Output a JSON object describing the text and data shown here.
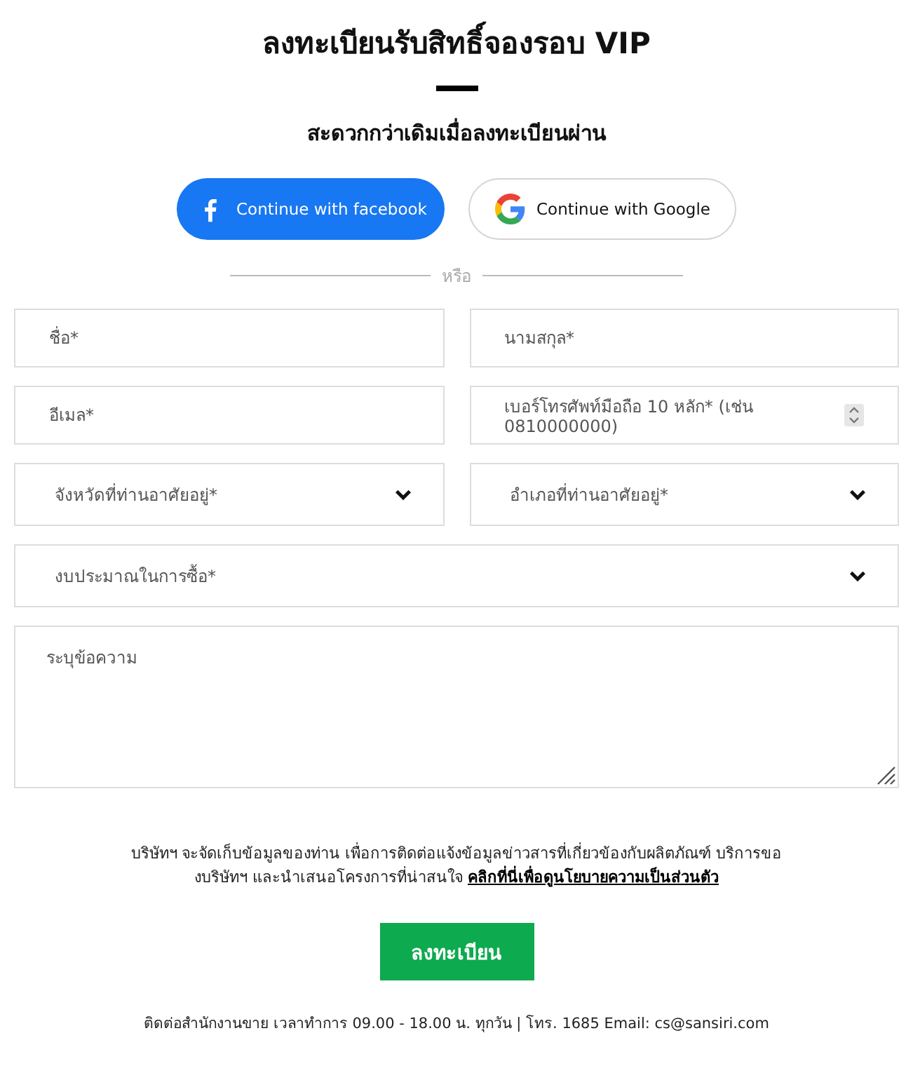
{
  "title": "ลงทะเบียนรับสิทธิ์จองรอบ VIP",
  "subtitle": "สะดวกกว่าเดิมเมื่อลงทะเบียนผ่าน",
  "social_buttons": [
    {
      "kind": "facebook",
      "label": "Continue with facebook"
    },
    {
      "kind": "google",
      "label": "Continue with Google"
    }
  ],
  "divider": "หรือ",
  "field_rows": [
    [
      {
        "kind": "text",
        "placeholder": "ชื่อ*"
      },
      {
        "kind": "text",
        "placeholder": "นามสกุล*"
      }
    ],
    [
      {
        "kind": "text",
        "placeholder": "อีเมล*"
      },
      {
        "kind": "number",
        "placeholder": "เบอร์โทรศัพท์มือถือ 10 หลัก* (เช่น 0810000000)"
      }
    ],
    [
      {
        "kind": "select",
        "placeholder": "จังหวัดที่ท่านอาศัยอยู่*"
      },
      {
        "kind": "select",
        "placeholder": "อำเภอที่ท่านอาศัยอยู่*"
      }
    ],
    [
      {
        "kind": "select",
        "placeholder": "งบประมาณในการซื้อ*"
      }
    ],
    [
      {
        "kind": "textarea",
        "placeholder": "ระบุข้อความ"
      }
    ]
  ],
  "consent": {
    "text": "บริษัทฯ จะจัดเก็บข้อมูลของท่าน เพื่อการติดต่อแจ้งข้อมูลข่าวสารที่เกี่ยวข้องกับผลิตภัณฑ์ บริการของบริษัทฯ และนำเสนอโครงการที่น่าสนใจ",
    "link": "คลิกที่นี่เพื่อดูนโยบายความเป็นส่วนตัว"
  },
  "submit": "ลงทะเบียน",
  "footer": "ติดต่อสำนักงานขาย เวลาทำการ 09.00 - 18.00 น. ทุกวัน | โทร. 1685 Email: cs@sansiri.com"
}
